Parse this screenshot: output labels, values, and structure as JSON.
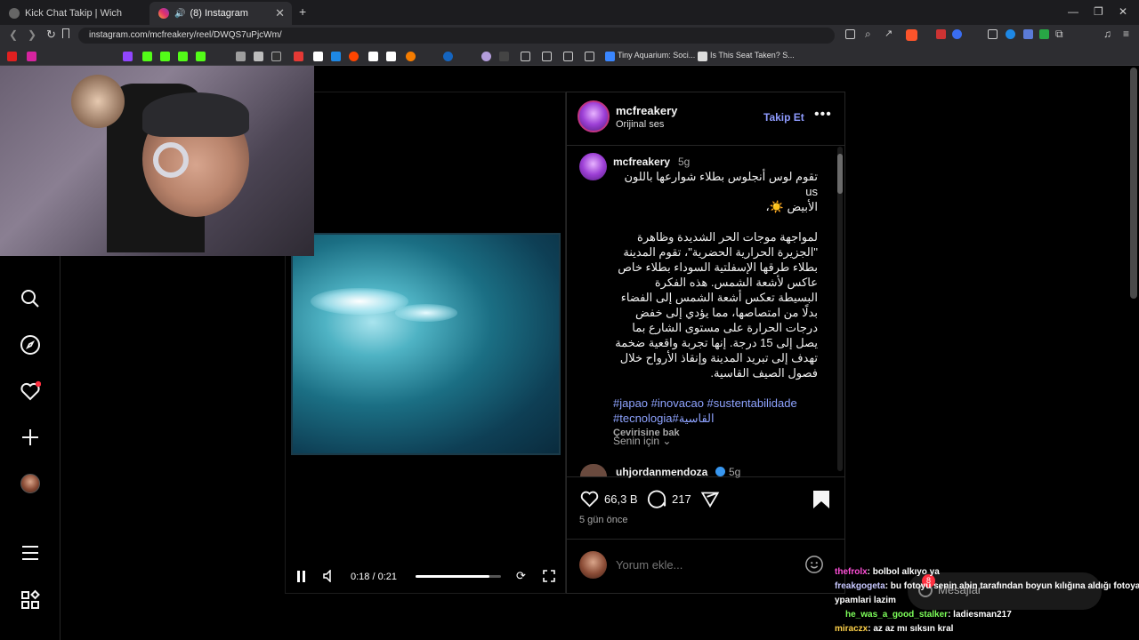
{
  "browser": {
    "tabs": [
      {
        "title": "Kick Chat Takip | Wich",
        "active": false
      },
      {
        "title": "(8) Instagram",
        "active": true
      }
    ],
    "new_tab_symbol": "+",
    "url": "instagram.com/mcfreakery/reel/DWQS7uPjcWm/",
    "bookmarks": [
      {
        "label": "Tiny Aquarium: Soci..."
      },
      {
        "label": "Is This Seat Taken? S..."
      }
    ]
  },
  "post": {
    "username": "mcfreakery",
    "audio": "Orijinal ses",
    "follow_label": "Takip Et",
    "more_icon": "more-horizontal-icon",
    "caption_author": "mcfreakery",
    "caption_age": "5g",
    "caption_line1": "تقوم لوس أنجلوس بطلاء شوارعها باللون us",
    "caption_line2": "الأبيض ☀️،",
    "caption_body": "لمواجهة موجات الحر الشديدة وظاهرة \"الجزيرة الحرارية الحضرية\"، تقوم المدينة بطلاء طرقها الإسفلتية السوداء بطلاء خاص عاكس لأشعة الشمس. هذه الفكرة البسيطة تعكس أشعة الشمس إلى الفضاء بدلًا من امتصاصها، مما يؤدي إلى خفض درجات الحرارة على مستوى الشارع بما يصل إلى 15 درجة. إنها تجربة واقعية ضخمة تهدف إلى تبريد المدينة وإنقاذ الأرواح خلال فصول الصيف القاسية.",
    "hashtags_line1": "#japao #inovacao #sustentabilidade",
    "hashtags_line2": "#tecnologia#القاسية",
    "translate_label": "Çevirisine bak",
    "for_you_label": "Senin için",
    "comment_user": "uhjordanmendoza",
    "comment_age": "5g",
    "likes": "66,3 B",
    "comments": "217",
    "posted_ago": "5 gün önce",
    "comment_placeholder": "Yorum ekle..."
  },
  "video": {
    "time": "0:18 / 0:21",
    "progress": 0.86
  },
  "chat": [
    {
      "user": "thefrolx",
      "message": ": bolbol alkıyo ya",
      "color": "#ff4fd8"
    },
    {
      "user": "freakgogeta",
      "message": ": bu fotoyu senin abin tarafından boyun kılığına aldığı fotoya",
      "color": "#c8c8ff"
    },
    {
      "user": "",
      "message": "ypamlari lazim",
      "color": "#ffffff"
    },
    {
      "user": "he_was_a_good_stalker",
      "message": ": ladiesman217",
      "color": "#7dff5a"
    },
    {
      "user": "miraczx",
      "message": ": az az mı sıksın kral",
      "color": "#ffd24a"
    }
  ],
  "messages_label": "Mesajlar",
  "messages_badge": "8",
  "colors": {
    "accent": "#4f6cff",
    "notification_dot": "#ff3040",
    "verified": "#3897f0"
  }
}
